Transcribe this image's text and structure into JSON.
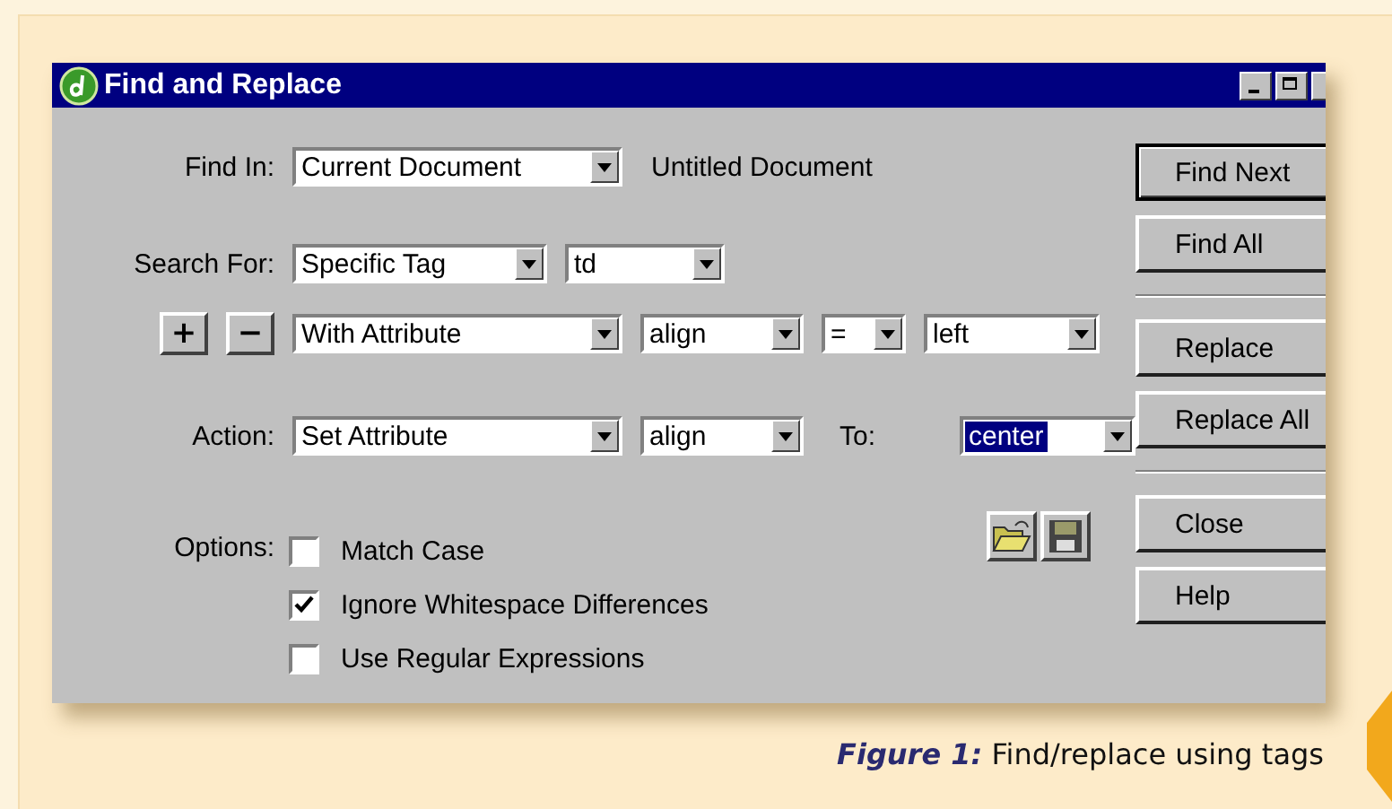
{
  "window": {
    "title": "Find and Replace"
  },
  "find_in": {
    "label": "Find In:",
    "value": "Current Document",
    "note": "Untitled Document"
  },
  "search_for": {
    "label": "Search For:",
    "values": [
      "Specific Tag",
      "td"
    ]
  },
  "condition": {
    "add": "+",
    "remove": "−",
    "values": [
      "With Attribute",
      "align",
      "=",
      "left"
    ]
  },
  "action": {
    "label": "Action:",
    "values": [
      "Set Attribute",
      "align"
    ],
    "to_label": "To:",
    "to_value": "center",
    "to_selected": true
  },
  "options": {
    "label": "Options:",
    "items": [
      {
        "label": "Match Case",
        "checked": false
      },
      {
        "label": "Ignore Whitespace Differences",
        "checked": true
      },
      {
        "label": "Use Regular Expressions",
        "checked": false
      }
    ]
  },
  "button_groups": [
    [
      {
        "label": "Find Next",
        "default": true
      },
      {
        "label": "Find All",
        "default": false
      }
    ],
    [
      {
        "label": "Replace",
        "default": false
      },
      {
        "label": "Replace All",
        "default": false
      }
    ],
    [
      {
        "label": "Close",
        "default": false
      },
      {
        "label": "Help",
        "default": false
      }
    ]
  ],
  "caption": {
    "label": "Figure 1:",
    "text": "Find/replace using tags"
  }
}
